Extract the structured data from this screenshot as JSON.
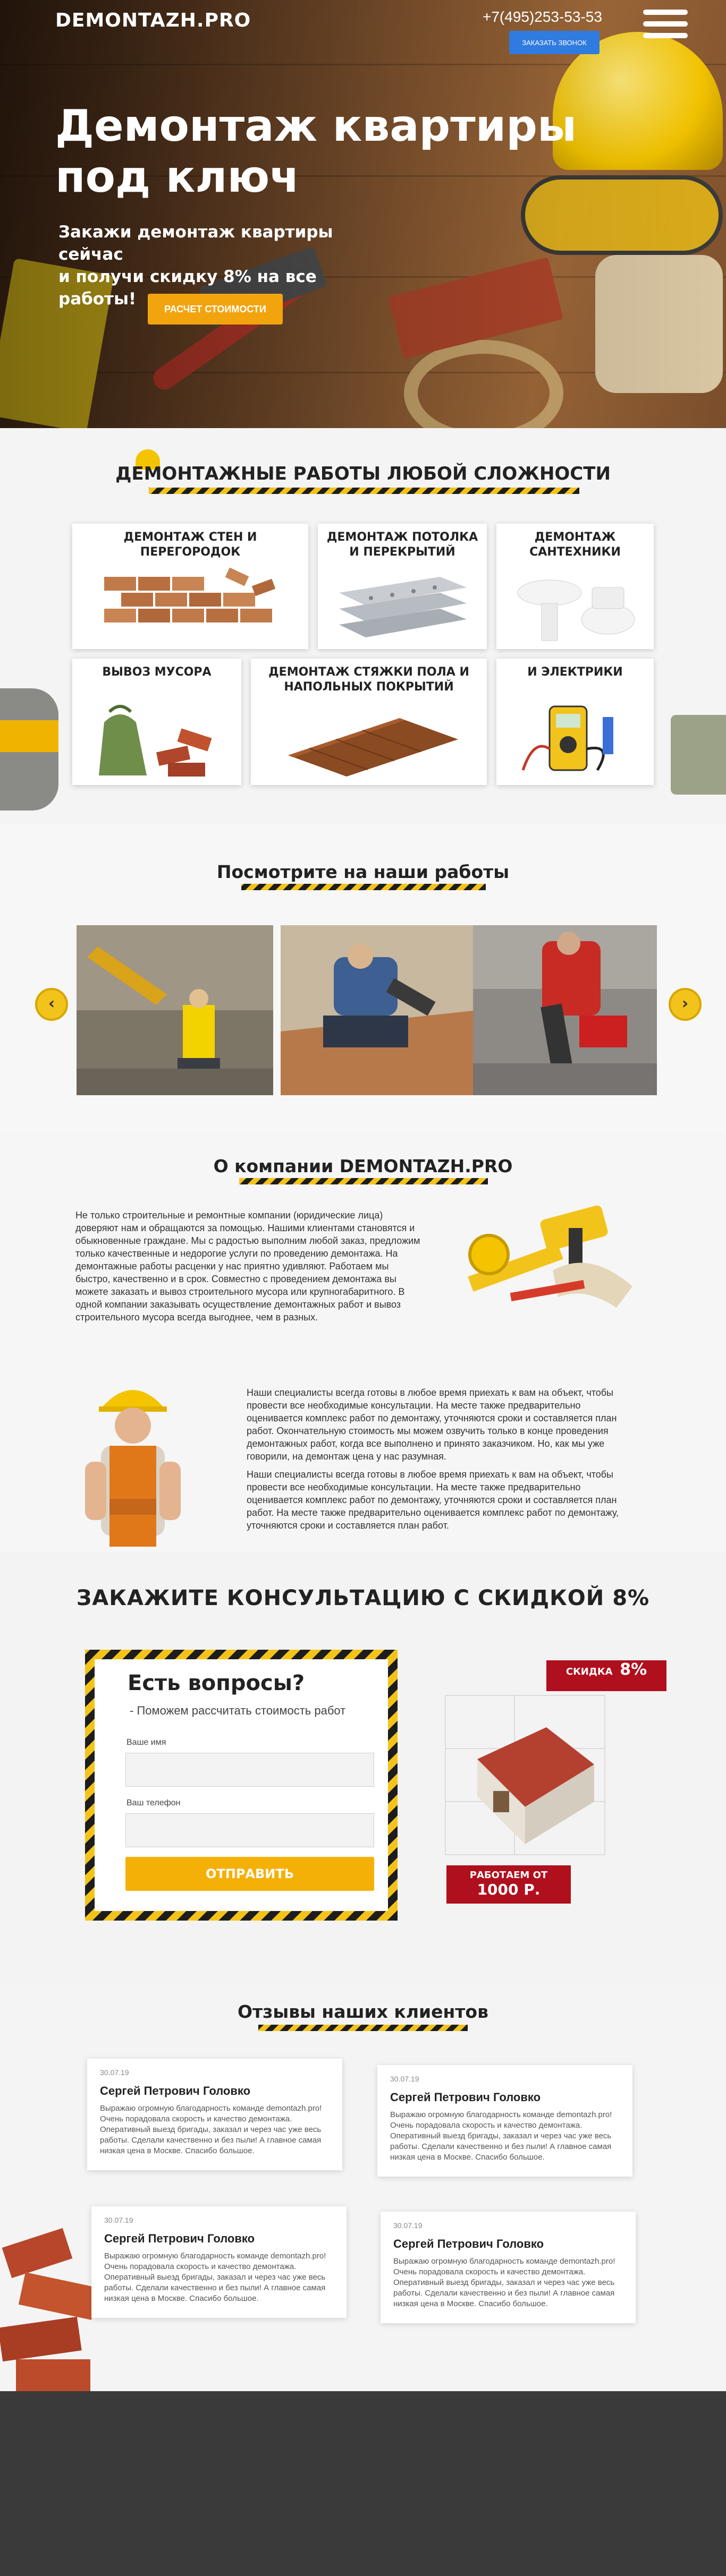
{
  "header": {
    "logo": "DEMONTAZH.PRO",
    "phone": "+7(495)253-53-53",
    "callback_label": "Заказать звонок",
    "menu_icon": "hamburger-icon"
  },
  "hero": {
    "title": "Демонтаж квартиры под ключ",
    "subtitle_line1": "Закажи демонтаж квартиры сейчас",
    "subtitle_line2": "и получи скидку 8% на все работы!",
    "cta_label": "Расчет стоимости"
  },
  "services": {
    "title": "Демонтажные работы любой сложности",
    "items": [
      {
        "label": "Демонтаж стен и перегородок"
      },
      {
        "label": "Демонтаж потолка и перекрытий"
      },
      {
        "label": "Демонтаж сантехники"
      },
      {
        "label": "Вывоз мусора"
      },
      {
        "label": "Демонтаж стяжки пола и напольных покрытий"
      },
      {
        "label": "и электрики"
      }
    ]
  },
  "works": {
    "title": "Посмотрите на наши работы",
    "prev_icon": "chevron-left-icon",
    "next_icon": "chevron-right-icon"
  },
  "about": {
    "title": "О компании DEMONTAZH.PRO",
    "p1": "Не только строительные и ремонтные компании (юридические лица) доверяют нам и обращаются за помощью. Нашими клиентами становятся и обыкновенные граждане. Мы с радостью выполним любой заказ, предложим только качественные и недорогие услуги по проведению демонтажа. На демонтажные работы расценки у нас приятно удивляют. Работаем мы быстро, качественно и в срок. Совместно с проведением демонтажа вы можете заказать и вывоз строительного мусора или крупногабаритного. В одной компании заказывать осуществление демонтажных работ и вывоз строительного мусора всегда выгоднее, чем в разных.",
    "p2": "Наши специалисты всегда готовы в любое время приехать к вам на объект, чтобы провести все необходимые консультации. На месте также предварительно оценивается комплекс работ по демонтажу, уточняются сроки и составляется план работ. Окончательную стоимость мы можем озвучить только в конце проведения демонтажных работ, когда все выполнено и принято заказчиком. Но, как мы уже говорили, на демонтаж цена у нас разумная.",
    "p3": "Наши специалисты всегда готовы в любое время приехать к вам на объект, чтобы провести все необходимые консультации. На месте также предварительно оценивается комплекс работ по демонтажу, уточняются сроки и составляется план работ. На месте также предварительно оценивается комплекс работ по демонтажу, уточняются сроки и составляется план работ."
  },
  "consult": {
    "title": "ЗАКАЖИТЕ КОНСУЛЬТАЦИЮ С СКИДКОЙ 8%",
    "form_title": "Есть вопросы?",
    "form_subtitle": "- Поможем рассчитать стоимость работ",
    "name_label": "Ваше имя",
    "name_value": "",
    "phone_label": "Ваш телефон",
    "phone_value": "",
    "submit_label": "ОТПРАВИТЬ",
    "discount_prefix": "скидка",
    "discount_value": "8%",
    "price_line1": "Работаем от",
    "price_line2": "1000 Р."
  },
  "reviews": {
    "title": "Отзывы наших клиентов",
    "items": [
      {
        "date": "30.07.19",
        "name": "Сергей Петрович Головко",
        "text": "Выражаю огромную благодарность команде demontazh.pro! Очень порадовала скорость и качество демонтажа. Оперативный выезд бригады, заказал и через час уже весь работы. Сделали качественно и без пыли! А главное самая низкая цена в Москве. Спасибо большое."
      },
      {
        "date": "30.07.19",
        "name": "Сергей Петрович Головко",
        "text": "Выражаю огромную благодарность команде demontazh.pro! Очень порадовала скорость и качество демонтажа. Оперативный выезд бригады, заказал и через час уже весь работы. Сделали качественно и без пыли! А главное самая низкая цена в Москве. Спасибо большое."
      },
      {
        "date": "30.07.19",
        "name": "Сергей Петрович Головко",
        "text": "Выражаю огромную благодарность команде demontazh.pro! Очень порадовала скорость и качество демонтажа. Оперативный выезд бригады, заказал и через час уже весь работы. Сделали качественно и без пыли! А главное самая низкая цена в Москве. Спасибо большое."
      },
      {
        "date": "30.07.19",
        "name": "Сергей Петрович Головко",
        "text": "Выражаю огромную благодарность команде demontazh.pro! Очень порадовала скорость и качество демонтажа. Оперативный выезд бригады, заказал и через час уже весь работы. Сделали качественно и без пыли! А главное самая низкая цена в Москве. Спасибо большое."
      }
    ]
  },
  "colors": {
    "accent": "#f2a40f",
    "button_blue": "#2f7be0",
    "ribbon_red": "#b00f1d",
    "footer": "#3a3a3a"
  }
}
